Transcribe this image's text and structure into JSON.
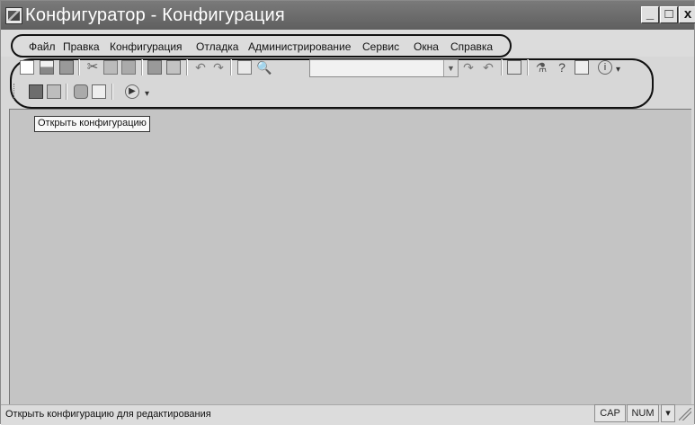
{
  "window": {
    "title": "Конфигуратор - Конфигурация",
    "min_glyph": "_",
    "max_glyph": "□",
    "close_glyph": "x"
  },
  "menu": {
    "items": [
      {
        "label": "Файл"
      },
      {
        "label": "Правка"
      },
      {
        "label": "Конфигурация"
      },
      {
        "label": "Отладка"
      },
      {
        "label": "Администрирование"
      },
      {
        "label": "Сервис"
      },
      {
        "label": "Окна"
      },
      {
        "label": "Справка"
      }
    ]
  },
  "toolbar": {
    "icons_row1": [
      "new-document-icon",
      "open-icon",
      "save-icon",
      "cut-icon",
      "copy-icon",
      "paste-icon",
      "print-icon",
      "print-preview-icon",
      "undo-icon",
      "redo-icon",
      "find-icon",
      "search-icon",
      "find-next-icon",
      "find-previous-icon",
      "window-icon",
      "wizard-icon",
      "help-icon",
      "syntax-helper-icon",
      "info-icon"
    ],
    "icons_row2": [
      "open-configuration-icon",
      "save-configuration-icon",
      "database-icon",
      "table-icon",
      "run-icon"
    ],
    "search_value": ""
  },
  "tooltip": {
    "text": "Открыть конфигурацию"
  },
  "status": {
    "message": "Открыть конфигурацию для редактирования",
    "cap": "CAP",
    "num": "NUM",
    "arrow": "▾"
  }
}
